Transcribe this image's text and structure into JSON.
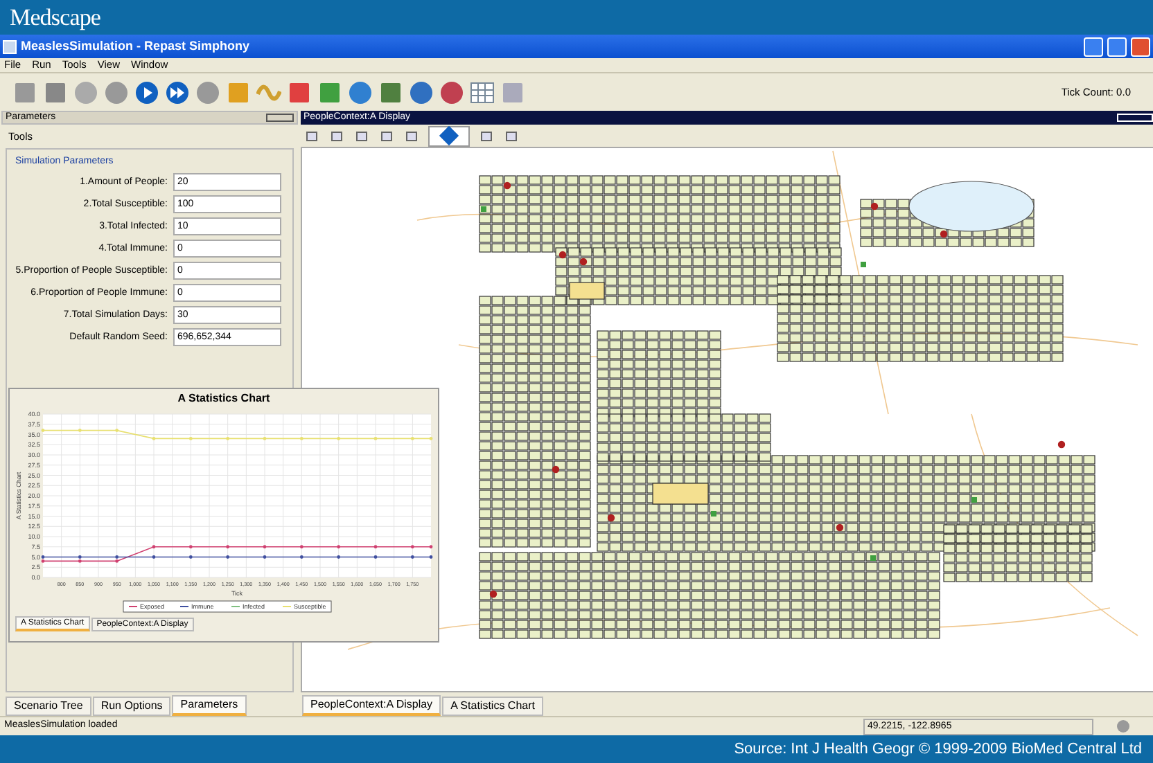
{
  "brand": "Medscape",
  "window": {
    "title": "MeaslesSimulation - Repast Simphony"
  },
  "menu": [
    "File",
    "Run",
    "Tools",
    "View",
    "Window"
  ],
  "tick_count": "Tick Count: 0.0",
  "left_panel": {
    "title": "Parameters",
    "section": "Tools",
    "group_title": "Simulation Parameters",
    "parameters": [
      {
        "label": "1.Amount of People:",
        "value": "20"
      },
      {
        "label": "2.Total Susceptible:",
        "value": "100"
      },
      {
        "label": "3.Total Infected:",
        "value": "10"
      },
      {
        "label": "4.Total Immune:",
        "value": "0"
      },
      {
        "label": "5.Proportion of People Susceptible:",
        "value": "0"
      },
      {
        "label": "6.Proportion of People Immune:",
        "value": "0"
      },
      {
        "label": "7.Total Simulation Days:",
        "value": "30"
      },
      {
        "label": "Default Random Seed:",
        "value": "696,652,344"
      }
    ]
  },
  "display": {
    "title": "PeopleContext:A Display",
    "tools": [
      {
        "selected": false
      },
      {
        "selected": false
      },
      {
        "selected": false
      },
      {
        "selected": false
      },
      {
        "selected": false
      },
      {
        "selected": true
      },
      {
        "selected": false
      },
      {
        "selected": false
      }
    ]
  },
  "chart_window": {
    "tabs": [
      {
        "label": "A Statistics Chart",
        "selected": true
      },
      {
        "label": "PeopleContext:A Display",
        "selected": false
      }
    ],
    "chart_data": {
      "type": "line",
      "title": "A Statistics Chart",
      "xlabel": "Tick",
      "ylabel": "A Statistics Chart",
      "x": [
        750,
        850,
        950,
        1050,
        1150,
        1250,
        1350,
        1450,
        1550,
        1650,
        1750,
        1800
      ],
      "series": [
        {
          "name": "Exposed",
          "color": "#d04070",
          "values": [
            4,
            4,
            4,
            7.5,
            7.5,
            7.5,
            7.5,
            7.5,
            7.5,
            7.5,
            7.5,
            7.5
          ]
        },
        {
          "name": "Immune",
          "color": "#4050a0",
          "values": [
            5,
            5,
            5,
            5,
            5,
            5,
            5,
            5,
            5,
            5,
            5,
            5
          ]
        },
        {
          "name": "Infected",
          "color": "#80c080",
          "values": [
            null,
            null,
            null,
            null,
            null,
            null,
            null,
            null,
            null,
            null,
            null,
            null
          ]
        },
        {
          "name": "Susceptible",
          "color": "#e8e070",
          "values": [
            36,
            36,
            36,
            34,
            34,
            34,
            34,
            34,
            34,
            34,
            34,
            34
          ]
        }
      ],
      "xlim": [
        750,
        1800
      ],
      "ylim": [
        0,
        40
      ],
      "grid": true,
      "legend": true,
      "xticks": [
        {
          "value": 800,
          "label": "800"
        },
        {
          "value": 850,
          "label": "850"
        },
        {
          "value": 900,
          "label": "900"
        },
        {
          "value": 950,
          "label": "950"
        },
        {
          "value": 1000,
          "label": "1,000"
        },
        {
          "value": 1050,
          "label": "1,050"
        },
        {
          "value": 1100,
          "label": "1,100"
        },
        {
          "value": 1150,
          "label": "1,150"
        },
        {
          "value": 1200,
          "label": "1,200"
        },
        {
          "value": 1250,
          "label": "1,250"
        },
        {
          "value": 1300,
          "label": "1,300"
        },
        {
          "value": 1350,
          "label": "1,350"
        },
        {
          "value": 1400,
          "label": "1,400"
        },
        {
          "value": 1450,
          "label": "1,450"
        },
        {
          "value": 1500,
          "label": "1,500"
        },
        {
          "value": 1550,
          "label": "1,550"
        },
        {
          "value": 1600,
          "label": "1,600"
        },
        {
          "value": 1650,
          "label": "1,650"
        },
        {
          "value": 1700,
          "label": "1,700"
        },
        {
          "value": 1750,
          "label": "1,750"
        }
      ],
      "yticks": [
        {
          "value": 0,
          "label": "0.0"
        },
        {
          "value": 2.5,
          "label": "2.5"
        },
        {
          "value": 5,
          "label": "5.0"
        },
        {
          "value": 7.5,
          "label": "7.5"
        },
        {
          "value": 10,
          "label": "10.0"
        },
        {
          "value": 12.5,
          "label": "12.5"
        },
        {
          "value": 15,
          "label": "15.0"
        },
        {
          "value": 17.5,
          "label": "17.5"
        },
        {
          "value": 20,
          "label": "20.0"
        },
        {
          "value": 22.5,
          "label": "22.5"
        },
        {
          "value": 25,
          "label": "25.0"
        },
        {
          "value": 27.5,
          "label": "27.5"
        },
        {
          "value": 30,
          "label": "30.0"
        },
        {
          "value": 32.5,
          "label": "32.5"
        },
        {
          "value": 35,
          "label": "35.0"
        },
        {
          "value": 37.5,
          "label": "37.5"
        },
        {
          "value": 40,
          "label": "40.0"
        }
      ]
    }
  },
  "left_tabs": [
    {
      "label": "Scenario Tree",
      "selected": false
    },
    {
      "label": "Run Options",
      "selected": false
    },
    {
      "label": "Parameters",
      "selected": true
    }
  ],
  "right_tabs": [
    {
      "label": "PeopleContext:A Display",
      "selected": true
    },
    {
      "label": "A Statistics Chart",
      "selected": false
    }
  ],
  "status_bar": {
    "message": "MeaslesSimulation loaded",
    "coordinates": "49.2215, -122.8965"
  },
  "source": "Source: Int J Health Geogr © 1999-2009 BioMed Central Ltd"
}
